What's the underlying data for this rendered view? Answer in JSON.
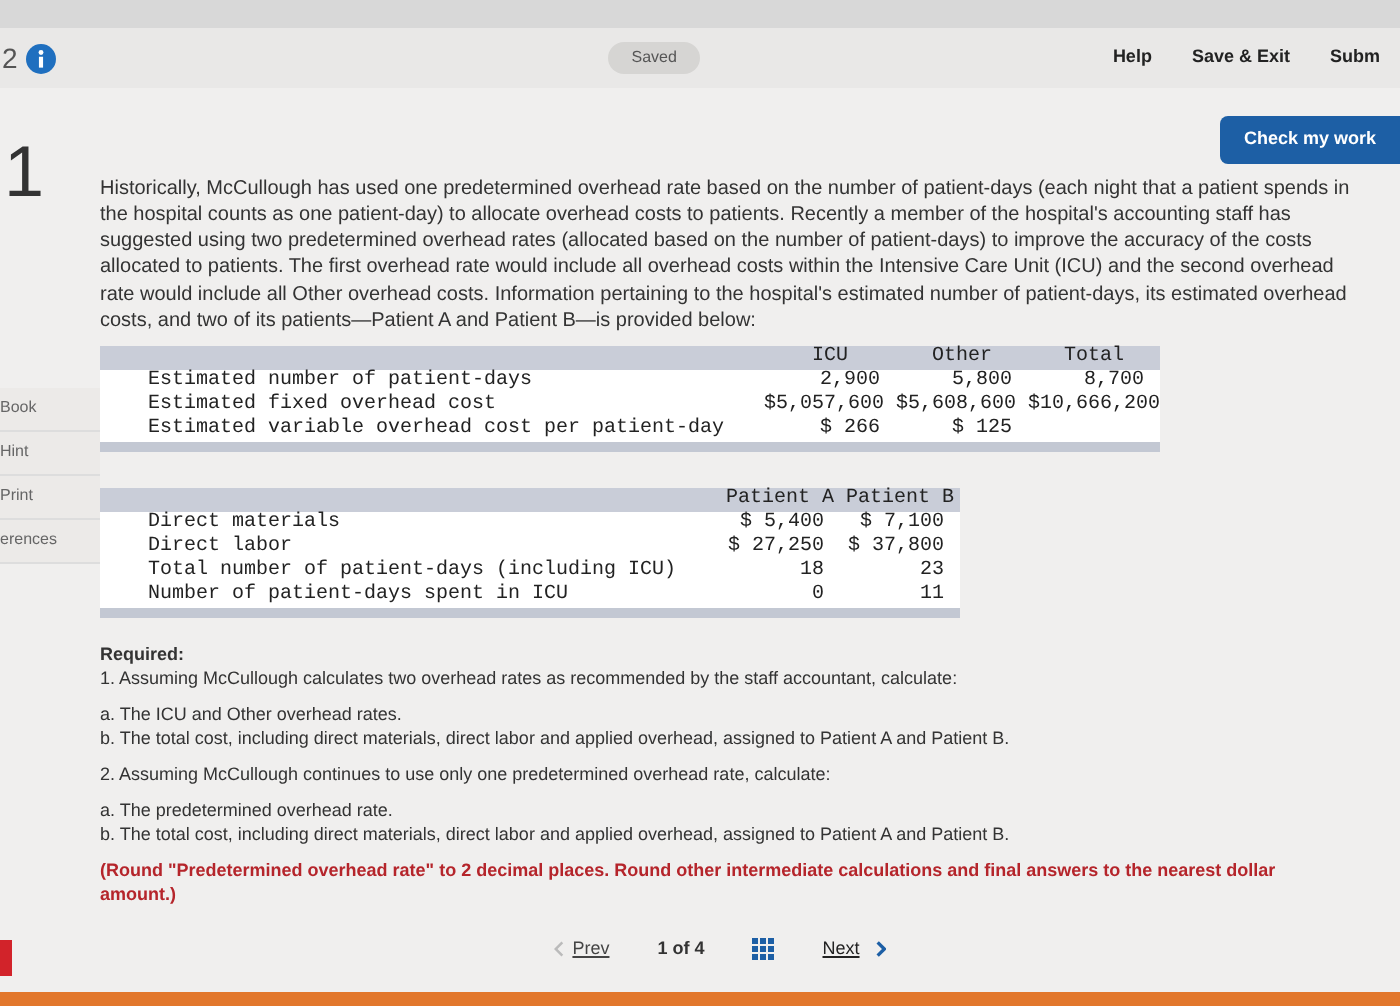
{
  "header": {
    "question_number_cut": "2",
    "status": "Saved",
    "links": [
      "Help",
      "Save & Exit",
      "Subm"
    ]
  },
  "check_button": "Check my work",
  "question_number": "1",
  "sidebar": {
    "items": [
      "Book",
      "Hint",
      "Print",
      "erences"
    ]
  },
  "intro": "Historically, McCullough has used one predetermined overhead rate based on the number of patient-days (each night that a patient spends in the hospital counts as one patient-day) to allocate overhead costs to patients. Recently a member of the hospital's accounting staff has suggested using two predetermined overhead rates (allocated based on the number of patient-days) to improve the accuracy of the costs allocated to patients. The first overhead rate would include all overhead costs within the Intensive Care Unit (ICU) and the second overhead rate would include all Other overhead costs. Information pertaining to the hospital's estimated number of patient-days, its estimated overhead costs, and two of its patients—Patient A and Patient B—is provided below:",
  "table_costs": {
    "columns": [
      "ICU",
      "Other",
      "Total"
    ],
    "rows": [
      {
        "label": "Estimated number of patient-days",
        "cells": [
          "2,900",
          "5,800",
          "8,700"
        ]
      },
      {
        "label": "Estimated fixed overhead cost",
        "cells": [
          "$5,057,600",
          "$5,608,600",
          "$10,666,200"
        ]
      },
      {
        "label": "Estimated variable overhead cost per patient-day",
        "cells": [
          "$ 266",
          "$ 125",
          ""
        ]
      }
    ]
  },
  "table_patients": {
    "columns": [
      "Patient A",
      "Patient B"
    ],
    "rows": [
      {
        "label": "Direct materials",
        "cells": [
          "$ 5,400",
          "$ 7,100"
        ]
      },
      {
        "label": "Direct labor",
        "cells": [
          "$ 27,250",
          "$ 37,800"
        ]
      },
      {
        "label": "Total number of patient-days (including ICU)",
        "cells": [
          "18",
          "23"
        ]
      },
      {
        "label": "Number of patient-days spent in ICU",
        "cells": [
          "0",
          "11"
        ]
      }
    ]
  },
  "required": {
    "heading": "Required:",
    "parts": [
      {
        "title": "1. Assuming McCullough calculates two overhead rates as recommended by the staff accountant, calculate:",
        "items": [
          "a. The ICU and Other overhead rates.",
          "b. The total cost, including direct materials, direct labor and applied overhead, assigned to Patient A and Patient B."
        ]
      },
      {
        "title": "2. Assuming McCullough continues to use only one predetermined overhead rate, calculate:",
        "items": [
          "a. The predetermined overhead rate.",
          "b. The total cost, including direct materials, direct labor and applied overhead, assigned to Patient A and Patient B."
        ]
      }
    ],
    "note": "(Round \"Predetermined overhead rate\" to 2 decimal places. Round other intermediate calculations and final answers to the nearest dollar amount.)"
  },
  "pager": {
    "prev": "Prev",
    "position": "1 of 4",
    "next": "Next"
  }
}
